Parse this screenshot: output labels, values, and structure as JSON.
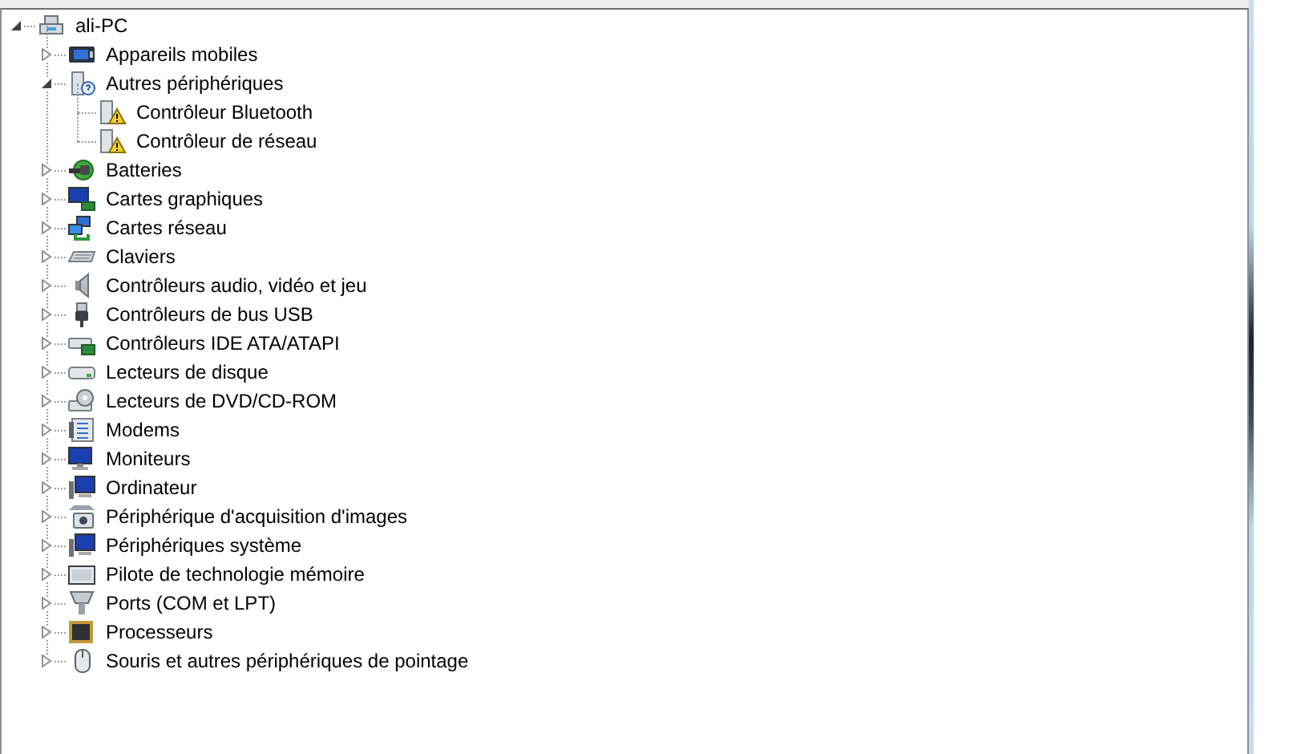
{
  "tree": [
    {
      "label": "ali-PC",
      "expanded": true,
      "children": [
        {
          "label": "Appareils mobiles",
          "expanded": false
        },
        {
          "label": "Autres périphériques",
          "expanded": true,
          "children": [
            {
              "label": "Contrôleur Bluetooth"
            },
            {
              "label": "Contrôleur de réseau"
            }
          ]
        },
        {
          "label": "Batteries",
          "expanded": false
        },
        {
          "label": "Cartes graphiques",
          "expanded": false
        },
        {
          "label": "Cartes réseau",
          "expanded": false
        },
        {
          "label": "Claviers",
          "expanded": false
        },
        {
          "label": "Contrôleurs audio, vidéo et jeu",
          "expanded": false
        },
        {
          "label": "Contrôleurs de bus USB",
          "expanded": false
        },
        {
          "label": "Contrôleurs IDE ATA/ATAPI",
          "expanded": false
        },
        {
          "label": "Lecteurs de disque",
          "expanded": false
        },
        {
          "label": "Lecteurs de DVD/CD-ROM",
          "expanded": false
        },
        {
          "label": "Modems",
          "expanded": false
        },
        {
          "label": "Moniteurs",
          "expanded": false
        },
        {
          "label": "Ordinateur",
          "expanded": false
        },
        {
          "label": "Périphérique d'acquisition d'images",
          "expanded": false
        },
        {
          "label": "Périphériques système",
          "expanded": false
        },
        {
          "label": "Pilote de technologie mémoire",
          "expanded": false
        },
        {
          "label": "Ports (COM et LPT)",
          "expanded": false
        },
        {
          "label": "Processeurs",
          "expanded": false
        },
        {
          "label": "Souris et autres périphériques de pointage",
          "expanded": false
        }
      ]
    }
  ]
}
